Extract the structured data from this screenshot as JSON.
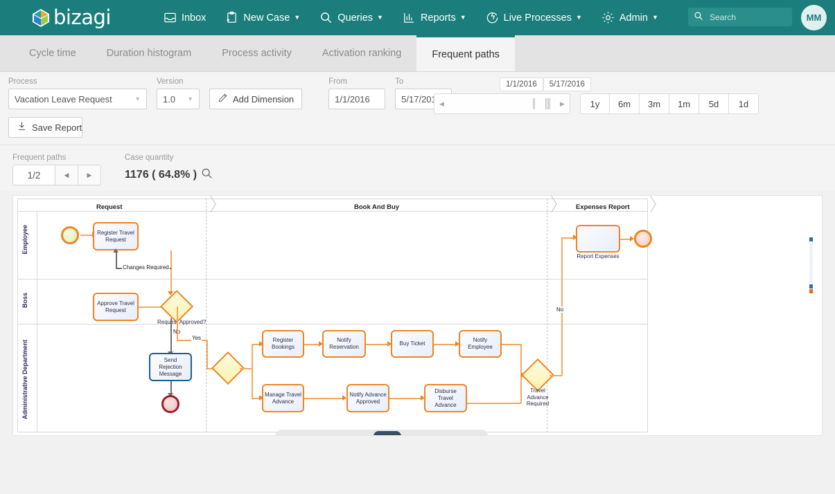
{
  "header": {
    "brand": "bizagi",
    "nav": [
      {
        "label": "Inbox",
        "icon": "inbox-icon",
        "caret": false
      },
      {
        "label": "New Case",
        "icon": "new-case-icon",
        "caret": true
      },
      {
        "label": "Queries",
        "icon": "search-icon",
        "caret": true
      },
      {
        "label": "Reports",
        "icon": "chart-icon",
        "caret": true
      },
      {
        "label": "Live Processes",
        "icon": "live-processes-icon",
        "caret": true
      },
      {
        "label": "Admin",
        "icon": "gear-icon",
        "caret": true
      }
    ],
    "search_placeholder": "Search",
    "avatar_initials": "MM",
    "brand_color": "#1b7e7c"
  },
  "tabs": [
    {
      "label": "Cycle time",
      "active": false
    },
    {
      "label": "Duration histogram",
      "active": false
    },
    {
      "label": "Process activity",
      "active": false
    },
    {
      "label": "Activation ranking",
      "active": false
    },
    {
      "label": "Frequent paths",
      "active": true
    }
  ],
  "filters": {
    "process_label": "Process",
    "process_value": "Vacation Leave Request",
    "version_label": "Version",
    "version_value": "1.0",
    "add_dimension_label": "Add Dimension",
    "from_label": "From",
    "from_value": "1/1/2016",
    "to_label": "To",
    "to_value": "5/17/2016",
    "save_report_label": "Save Report",
    "range_start": "1/1/2016",
    "range_end": "5/17/2016",
    "presets": [
      "1y",
      "6m",
      "3m",
      "1m",
      "5d",
      "1d"
    ]
  },
  "subbar": {
    "frequent_paths_label": "Frequent paths",
    "page_value": "1/2",
    "case_quantity_label": "Case quantity",
    "case_quantity_value": "1176 ( 64.8% )"
  },
  "diagram": {
    "phases": [
      {
        "label": "Request"
      },
      {
        "label": "Book And Buy"
      },
      {
        "label": "Expenses Report"
      }
    ],
    "lanes": [
      {
        "label": "Employee"
      },
      {
        "label": "Boss"
      },
      {
        "label": "Administrative Department"
      }
    ],
    "tasks": [
      {
        "label": "Register Travel Request"
      },
      {
        "label": "Approve Travel Request"
      },
      {
        "label": "Send Rejection Message"
      },
      {
        "label": "Register Bookings"
      },
      {
        "label": "Notify Reservation"
      },
      {
        "label": "Buy Ticket"
      },
      {
        "label": "Notify Employee"
      },
      {
        "label": "Manage Travel Advance"
      },
      {
        "label": "Notify Advance Approved"
      },
      {
        "label": "Disburse Travel Advance"
      },
      {
        "label": "Report Expenses"
      }
    ],
    "gateways": [
      {
        "label": "Request Approved?"
      },
      {
        "label": ""
      },
      {
        "label": "Travel Advance Required"
      }
    ],
    "edge_labels": [
      {
        "label": "Changes Required"
      },
      {
        "label": "No"
      },
      {
        "label": "Yes"
      },
      {
        "label": "No"
      }
    ]
  }
}
